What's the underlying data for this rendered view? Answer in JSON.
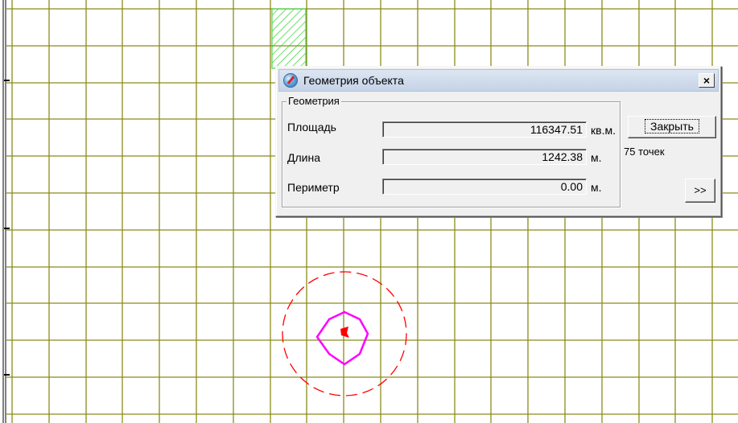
{
  "dialog": {
    "title": "Геометрия объекта",
    "close_glyph": "×",
    "icon": "globe-compass-icon",
    "group_label": "Геометрия",
    "rows": [
      {
        "label": "Площадь",
        "value": "116347.51",
        "unit": "кв.м."
      },
      {
        "label": "Длина",
        "value": "1242.38",
        "unit": "м."
      },
      {
        "label": "Периметр",
        "value": "0.00",
        "unit": "м."
      }
    ],
    "close_button_label": "Закрыть",
    "points_count": "75 точек",
    "more_button_label": ">>"
  },
  "map": {
    "grid_color": "#8b8b1a",
    "hatch_color": "#33cc33",
    "polygon_color": "#ff00ff",
    "buffer_circle_color": "#ff0000",
    "center_marker_color": "#ff0000"
  }
}
